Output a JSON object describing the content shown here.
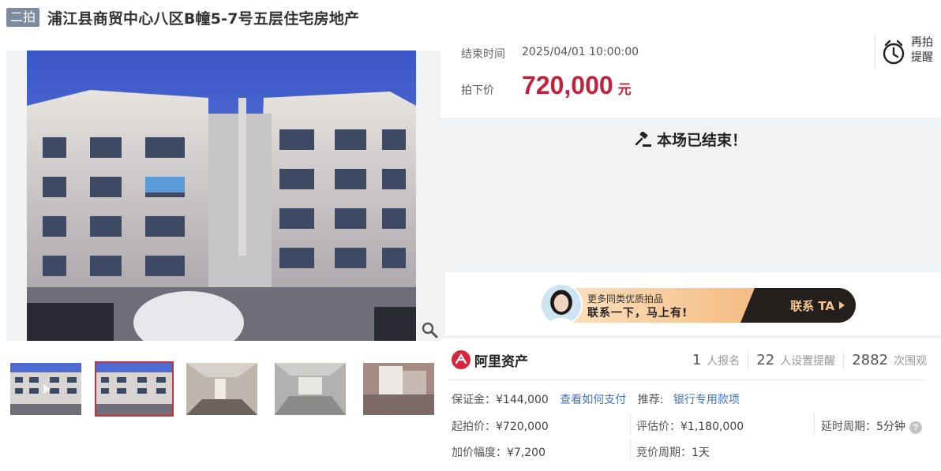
{
  "header": {
    "round_badge": "二拍",
    "title": "浦江县商贸中心八区B幢5-7号五层住宅房地产"
  },
  "gallery": {
    "main_photo": "apartment-building-photo",
    "thumbnails": [
      {
        "name": "thumb-video",
        "active": false
      },
      {
        "name": "thumb-building",
        "active": true
      },
      {
        "name": "thumb-room-1",
        "active": false
      },
      {
        "name": "thumb-room-2",
        "active": false
      },
      {
        "name": "thumb-kitchen",
        "active": false
      }
    ]
  },
  "auction": {
    "end_time_label": "结束时间",
    "end_time": "2025/04/01 10:00:00",
    "remind_label": "再拍\n提醒",
    "price_label": "拍下价",
    "price": "720,000",
    "price_unit": "元",
    "status": "本场已结束！"
  },
  "promo": {
    "subtitle": "更多同类优质拍品",
    "headline": "联系一下，马上有!",
    "button": "联系 TA"
  },
  "brand": {
    "name": "阿里资产"
  },
  "stats": [
    {
      "num": "1",
      "text": "人报名"
    },
    {
      "num": "22",
      "text": "人设置提醒"
    },
    {
      "num": "2882",
      "text": "次围观"
    }
  ],
  "details": {
    "deposit_label": "保证金：",
    "deposit": "¥144,000",
    "how_to_pay": "查看如何支付",
    "recommend_label": "推荐:",
    "recommend_link": "银行专用款项",
    "start_price_label": "起拍价：",
    "start_price": "¥720,000",
    "appraisal_label": "评估价：",
    "appraisal": "¥1,180,000",
    "delay_label": "延时周期：",
    "delay": "5分钟",
    "increment_label": "加价幅度：",
    "increment": "¥7,200",
    "bid_cycle_label": "竞价周期：",
    "bid_cycle": "1天"
  },
  "colors": {
    "price_red": "#c3223a",
    "badge_gray": "#7d8ba1",
    "link_blue": "#3b74c3",
    "active_thumb_border": "#c0333a"
  }
}
